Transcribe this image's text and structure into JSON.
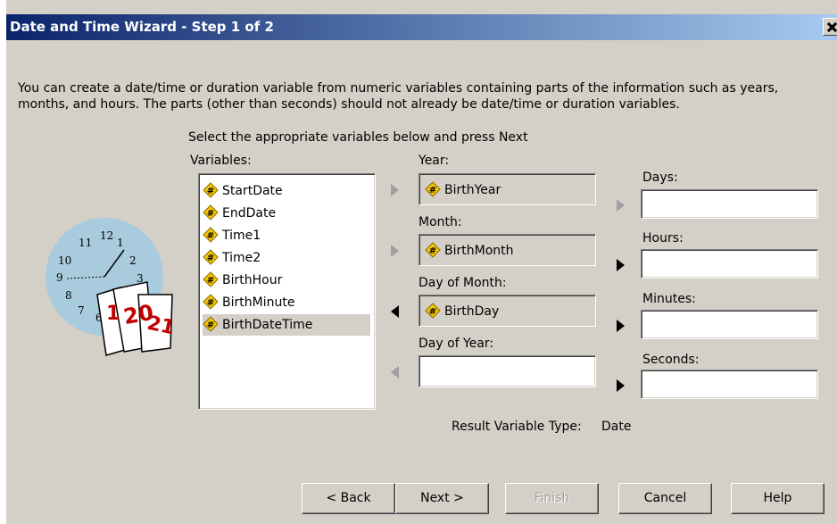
{
  "window": {
    "title": "Date and Time Wizard - Step 1 of 2"
  },
  "intro": "You can create a date/time or duration variable from numeric variables containing parts of the information such as years, months, and hours. The parts (other than seconds) should not already be date/time or duration variables.",
  "instruction": "Select the appropriate variables below and press Next",
  "variables": {
    "label": "Variables:",
    "items": [
      "StartDate",
      "EndDate",
      "Time1",
      "Time2",
      "BirthHour",
      "BirthMinute",
      "BirthDateTime"
    ],
    "selected": "BirthDateTime"
  },
  "fields": {
    "year": {
      "label": "Year:",
      "value": "BirthYear"
    },
    "month": {
      "label": "Month:",
      "value": "BirthMonth"
    },
    "day_of_month": {
      "label": "Day of Month:",
      "value": "BirthDay"
    },
    "day_of_year": {
      "label": "Day of Year:",
      "value": ""
    },
    "days": {
      "label": "Days:",
      "value": ""
    },
    "hours": {
      "label": "Hours:",
      "value": ""
    },
    "minutes": {
      "label": "Minutes:",
      "value": ""
    },
    "seconds": {
      "label": "Seconds:",
      "value": ""
    }
  },
  "result": {
    "label": "Result Variable Type:",
    "value": "Date"
  },
  "buttons": {
    "back": "< Back",
    "next": "Next >",
    "finish": "Finish",
    "cancel": "Cancel",
    "help": "Help"
  },
  "clock": {
    "numbers": [
      "12",
      "1",
      "2",
      "3",
      "6",
      "7",
      "8",
      "9",
      "10",
      "11"
    ],
    "calendar_pages": [
      "20",
      "21"
    ]
  },
  "icons": {
    "variable": "numeric-scale-variable-icon",
    "close": "close-icon",
    "arrow": "move-arrow-icon"
  },
  "colors": {
    "titlebar_start": "#0a246a",
    "titlebar_end": "#a6caf0",
    "dialog_bg": "#d4d0c8",
    "clock_face": "#a8cbdd"
  }
}
